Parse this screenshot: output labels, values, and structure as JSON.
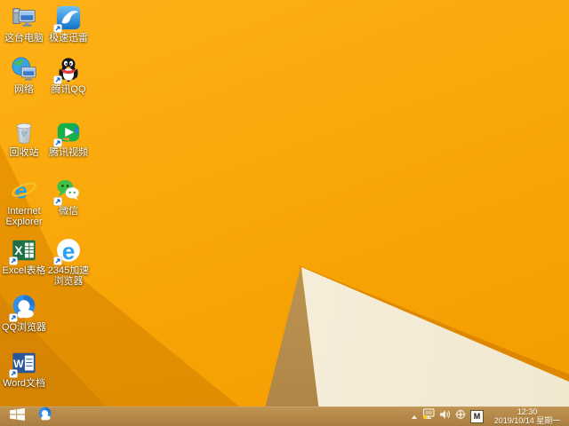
{
  "desktop": {
    "icons": [
      {
        "id": "this-pc",
        "label": "这台电脑",
        "shortcut": false
      },
      {
        "id": "xunlei",
        "label": "极速迅雷",
        "shortcut": true
      },
      {
        "id": "network",
        "label": "网络",
        "shortcut": false
      },
      {
        "id": "tencent-qq",
        "label": "腾讯QQ",
        "shortcut": true
      },
      {
        "id": "recycle-bin",
        "label": "回收站",
        "shortcut": false
      },
      {
        "id": "tencent-video",
        "label": "腾讯视频",
        "shortcut": true
      },
      {
        "id": "internet-explorer",
        "label": "Internet Explorer",
        "shortcut": false
      },
      {
        "id": "wechat",
        "label": "微信",
        "shortcut": true
      },
      {
        "id": "excel",
        "label": "Excel表格",
        "shortcut": true
      },
      {
        "id": "browser-2345",
        "label": "2345加速浏览器",
        "shortcut": true
      },
      {
        "id": "qq-browser",
        "label": "QQ浏览器",
        "shortcut": true
      },
      {
        "id": "word",
        "label": "Word文档",
        "shortcut": true
      }
    ]
  },
  "taskbar": {
    "pinned_apps": [
      {
        "id": "qq-browser-taskbar"
      }
    ],
    "tray": {
      "icons": [
        "show-hidden-icons",
        "network-warning",
        "volume",
        "crosshair-circle"
      ],
      "ime_indicator": "M",
      "clock_time": "12:30",
      "clock_date": "2019/10/14 星期一"
    }
  },
  "colors": {
    "wallpaper_base": "#f8a607",
    "wallpaper_dark_wedge": "#e08a02",
    "wallpaper_cream_triangle": "#f7f0de",
    "wallpaper_khaki_triangle": "#c29c58",
    "taskbar": "#b68c4c"
  }
}
